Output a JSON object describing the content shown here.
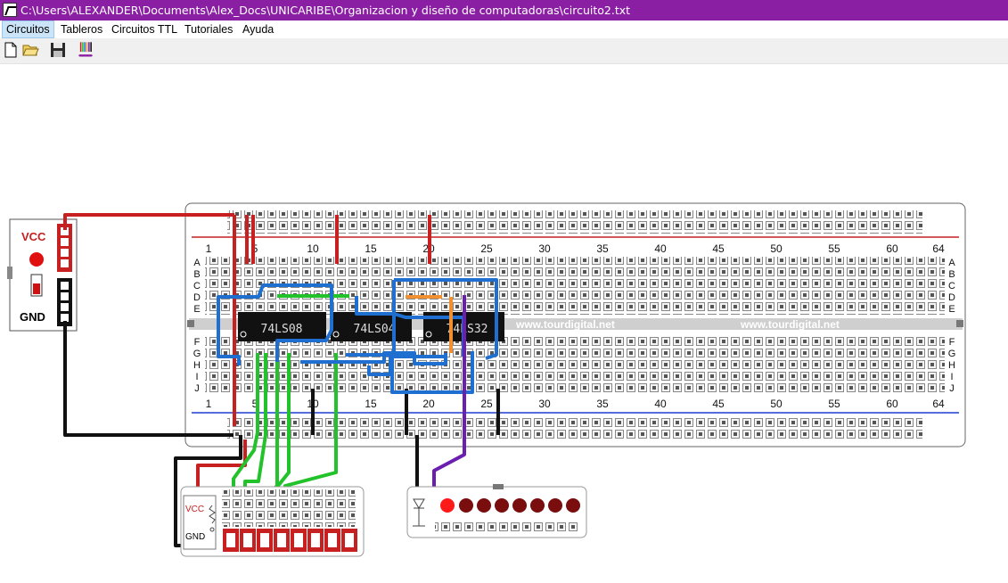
{
  "window": {
    "title": "C:\\Users\\ALEXANDER\\Documents\\Alex_Docs\\UNICARIBE\\Organizacion y diseño de computadoras\\circuito2.txt"
  },
  "menu": [
    "Circuitos",
    "Tableros",
    "Circuitos TTL",
    "Tutoriales",
    "Ayuda"
  ],
  "toolbar": [
    "new-file",
    "open-folder",
    "save",
    "wire-colors"
  ],
  "power": {
    "vcc": "VCC",
    "gnd": "GND"
  },
  "breadboard": {
    "numbers": [
      "1",
      "5",
      "10",
      "15",
      "20",
      "25",
      "30",
      "35",
      "40",
      "45",
      "50",
      "55",
      "60",
      "64"
    ],
    "rows_top": [
      "A",
      "B",
      "C",
      "D",
      "E"
    ],
    "rows_bottom": [
      "F",
      "G",
      "H",
      "I",
      "J"
    ],
    "watermark": "www.tourdigital.net"
  },
  "chips": [
    "74LS08",
    "74LS04",
    "74LS32"
  ],
  "input_panel": {
    "vcc": "VCC",
    "gnd": "GND"
  },
  "colors": {
    "titlebar": "#8b1fa3",
    "red": "#c62020",
    "black": "#111111",
    "green": "#22c22a",
    "blue": "#1e6fd0",
    "orange": "#f09030",
    "purple": "#6a1fb0"
  }
}
